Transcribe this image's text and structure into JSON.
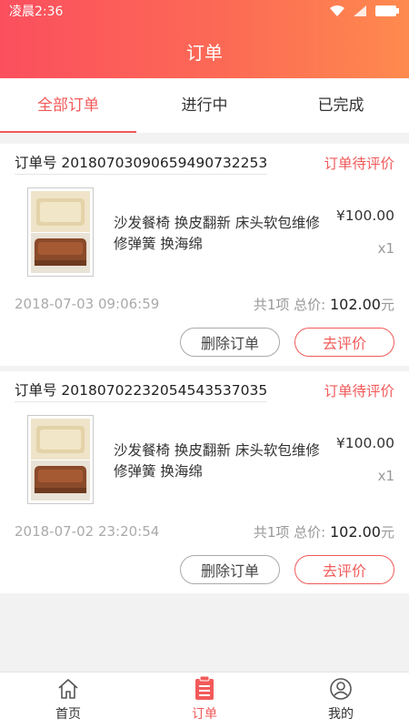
{
  "status_bar": {
    "time": "凌晨2:36"
  },
  "header": {
    "title": "订单"
  },
  "tabs": [
    {
      "label": "全部订单",
      "active": true
    },
    {
      "label": "进行中",
      "active": false
    },
    {
      "label": "已完成",
      "active": false
    }
  ],
  "orders": [
    {
      "order_no": "订单号 201807030906594907322​53",
      "status": "订单待评价",
      "item_name": "沙发餐椅 换皮翻新 床头软包维修 修弹簧 换海绵",
      "price": "¥100.00",
      "qty": "x1",
      "time": "2018-07-03 09:06:59",
      "summary_prefix": "共1项 总价:",
      "total": "102.00",
      "currency_unit": "元",
      "delete_label": "删除订单",
      "review_label": "去评价"
    },
    {
      "order_no": "订单号 20180702232054543537035",
      "status": "订单待评价",
      "item_name": "沙发餐椅 换皮翻新 床头软包维修 修弹簧 换海绵",
      "price": "¥100.00",
      "qty": "x1",
      "time": "2018-07-02 23:20:54",
      "summary_prefix": "共1项 总价:",
      "total": "102.00",
      "currency_unit": "元",
      "delete_label": "删除订单",
      "review_label": "去评价"
    }
  ],
  "bottom_nav": [
    {
      "label": "首页",
      "icon": "home-icon",
      "active": false
    },
    {
      "label": "订单",
      "icon": "clipboard-icon",
      "active": true
    },
    {
      "label": "我的",
      "icon": "user-icon",
      "active": false
    }
  ],
  "colors": {
    "accent": "#f25a5a",
    "header_start": "#fb4f5e",
    "header_end": "#fe8a4e"
  }
}
